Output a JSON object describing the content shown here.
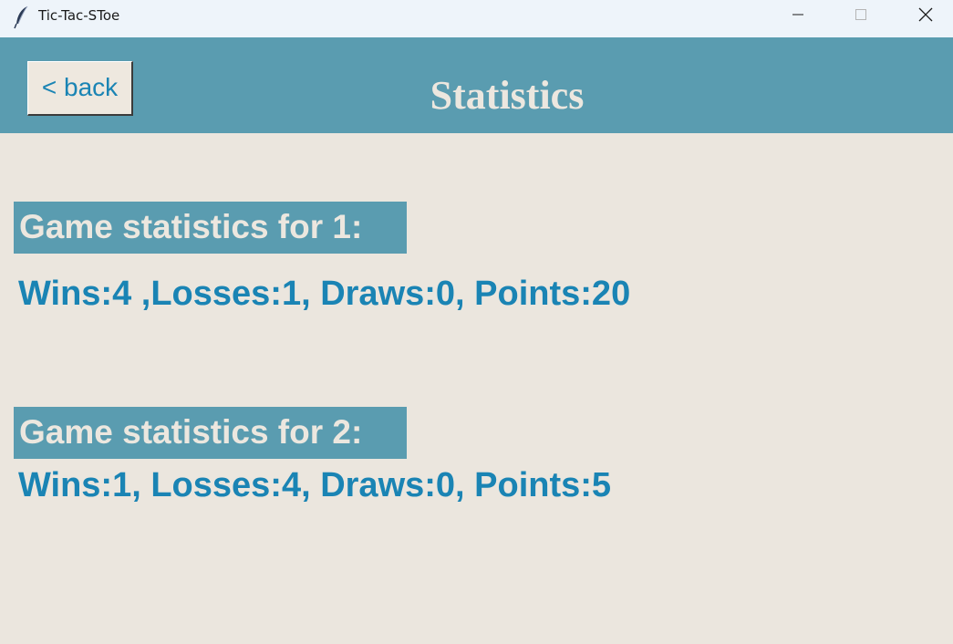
{
  "window": {
    "title": "Tic-Tac-SToe",
    "icon": "feather-icon",
    "controls": [
      "minimize-icon",
      "maximize-icon",
      "close-icon"
    ]
  },
  "header": {
    "back_label": "< back",
    "title": "Statistics",
    "color": "#5a9cb0"
  },
  "players": [
    {
      "label": "Game statistics for 1:",
      "stats": "Wins:4 ,Losses:1, Draws:0, Points:20"
    },
    {
      "label": "Game statistics for 2:",
      "stats": "Wins:1, Losses:4, Draws:0, Points:5"
    }
  ],
  "colors": {
    "background": "#ebe6de",
    "accent": "#1a84b4",
    "label_text": "#ece7df"
  }
}
